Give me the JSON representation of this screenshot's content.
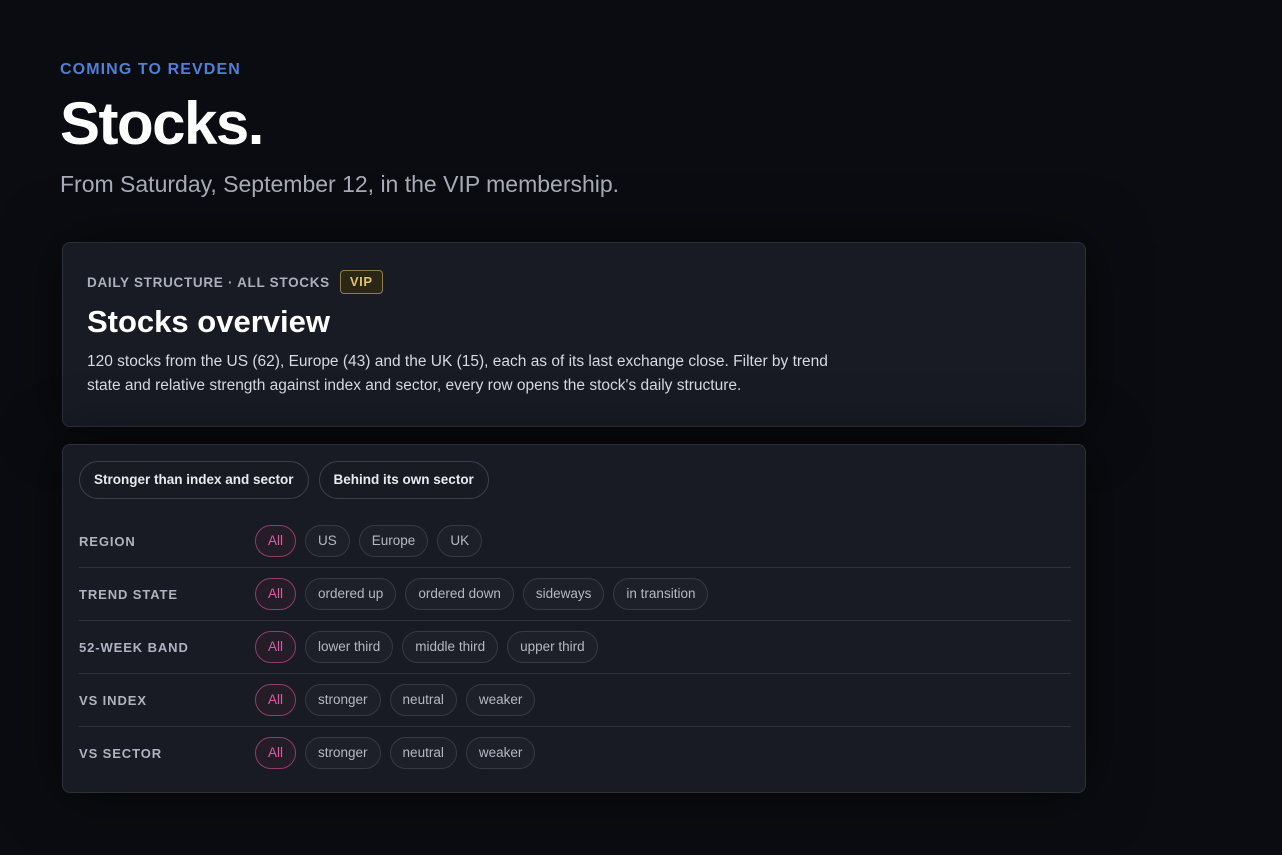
{
  "header": {
    "eyebrow": "COMING TO REVDEN",
    "title": "Stocks.",
    "subtitle": "From Saturday, September 12, in the VIP membership."
  },
  "overview": {
    "kicker": "DAILY STRUCTURE · ALL STOCKS",
    "badge": "VIP",
    "title": "Stocks overview",
    "description": "120 stocks from the US (62), Europe (43) and the UK (15), each as of its last exchange close. Filter by trend state and relative strength against index and sector, every row opens the stock's daily structure."
  },
  "presets": [
    "Stronger than index and sector",
    "Behind its own sector"
  ],
  "filters": [
    {
      "label": "REGION",
      "options": [
        "All",
        "US",
        "Europe",
        "UK"
      ],
      "selected": "All"
    },
    {
      "label": "TREND STATE",
      "options": [
        "All",
        "ordered up",
        "ordered down",
        "sideways",
        "in transition"
      ],
      "selected": "All"
    },
    {
      "label": "52-WEEK BAND",
      "options": [
        "All",
        "lower third",
        "middle third",
        "upper third"
      ],
      "selected": "All"
    },
    {
      "label": "VS INDEX",
      "options": [
        "All",
        "stronger",
        "neutral",
        "weaker"
      ],
      "selected": "All"
    },
    {
      "label": "VS SECTOR",
      "options": [
        "All",
        "stronger",
        "neutral",
        "weaker"
      ],
      "selected": "All"
    }
  ],
  "colors": {
    "background": "#0b0c11",
    "accent_blue": "#4f7fd6",
    "active_chip": "#e05aa4",
    "vip_gold": "#e0c26e"
  }
}
